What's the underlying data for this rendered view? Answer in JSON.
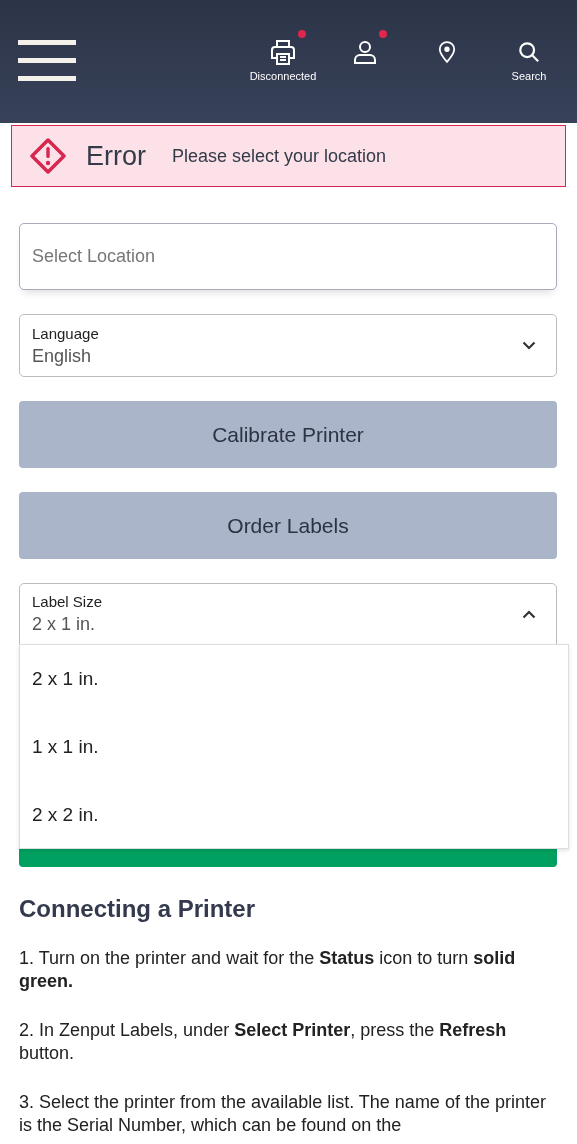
{
  "header": {
    "actions": [
      {
        "kind": "printer",
        "label": "Disconnected",
        "alert": true
      },
      {
        "kind": "user",
        "alert": true
      },
      {
        "kind": "location",
        "alert": false
      },
      {
        "kind": "search",
        "label": "Search",
        "alert": false
      }
    ]
  },
  "error": {
    "title": "Error",
    "message": "Please select your location"
  },
  "location_field": {
    "placeholder": "Select Location"
  },
  "language": {
    "label": "Language",
    "value": "English",
    "expanded": false
  },
  "buttons": [
    "Calibrate Printer",
    "Order Labels"
  ],
  "label_size": {
    "label": "Label Size",
    "value": "2 x 1 in.",
    "expanded": true,
    "options": [
      "2 x 1 in.",
      "1 x 1 in.",
      "2 x 2 in."
    ]
  },
  "instructions": {
    "heading": "Connecting a Printer",
    "steps": [
      "1. Turn on the printer and wait for the **Status** icon to turn **solid green.**",
      "2. In Zenput Labels, under **Select Printer**, press the **Refresh** button.",
      "3. Select the printer from the available list. The name of the printer is the Serial Number, which can be found on the"
    ]
  }
}
